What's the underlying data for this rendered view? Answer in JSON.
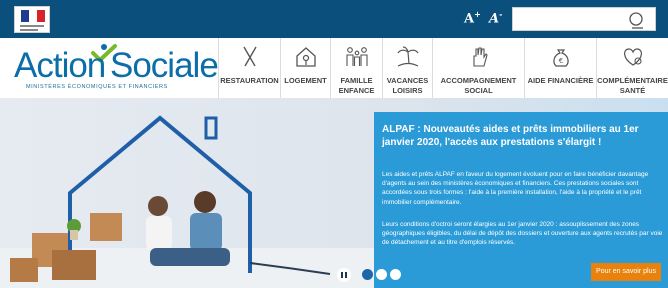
{
  "header": {
    "font_larger": "A",
    "font_smaller": "A",
    "search_placeholder": ""
  },
  "logo": {
    "word_a": "Action",
    "word_b": "Sociale",
    "tagline": "MINISTÈRES  ÉCONOMIQUES  ET  FINANCIERS"
  },
  "nav": [
    {
      "line1": "RESTAURATION",
      "line2": "",
      "icon": "cutlery-icon"
    },
    {
      "line1": "LOGEMENT",
      "line2": "",
      "icon": "house-key-icon"
    },
    {
      "line1": "FAMILLE",
      "line2": "ENFANCE",
      "icon": "family-icon"
    },
    {
      "line1": "VACANCES",
      "line2": "LOISIRS",
      "icon": "palm-tree-icon"
    },
    {
      "line1": "ACCOMPAGNEMENT",
      "line2": "SOCIAL",
      "icon": "helping-hand-icon"
    },
    {
      "line1": "AIDE FINANCIÈRE",
      "line2": "",
      "icon": "money-bag-icon"
    },
    {
      "line1": "COMPLÉMENTAIRE",
      "line2": "SANTÉ",
      "icon": "health-heart-icon"
    }
  ],
  "hero": {
    "title": "ALPAF : Nouveautés aides et prêts immobiliers au 1er janvier 2020, l'accès aux prestations s'élargit !",
    "paragraph1": "Les aides et prêts ALPAF en faveur du logement évoluent pour en faire bénéficier davantage d'agents au sein des ministères économiques et financiers. Ces prestations sociales sont accordées sous trois formes : l'aide à la première installation, l'aide à la propriété et le prêt immobilier complémentaire.",
    "paragraph2": "Leurs conditions d'octroi seront élargies au 1er janvier 2020 : assouplissement des zones géographiques éligibles, du délai de dépôt des dossiers et ouverture aux agents recrutés par voie de détachement et au titre d'emplois réservés.",
    "cta": "Pour en savoir plus"
  },
  "colors": {
    "topbar": "#0b4f7c",
    "brand_blue": "#0b6ea8",
    "logo_green": "#7ab929",
    "panel_blue": "#2b9bd7",
    "cta_orange": "#e9820c"
  }
}
